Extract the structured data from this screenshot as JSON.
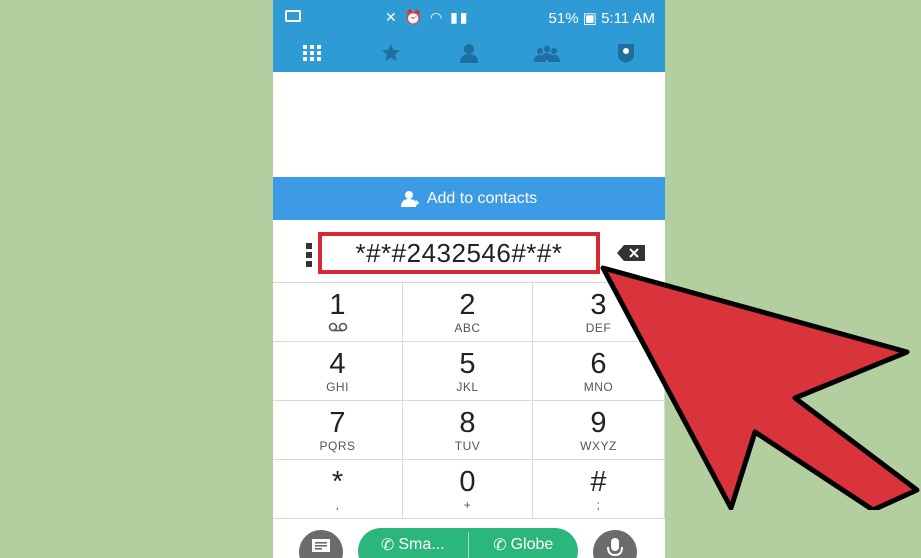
{
  "status_bar": {
    "battery": "51%",
    "time": "5:11 AM"
  },
  "tabs": [
    {
      "icon": "dialpad-icon"
    },
    {
      "icon": "star-icon"
    },
    {
      "icon": "person-icon"
    },
    {
      "icon": "group-icon"
    },
    {
      "icon": "shield-icon"
    }
  ],
  "add_contacts": {
    "label": "Add to contacts"
  },
  "dialed_number": "*#*#2432546#*#*",
  "keypad": [
    {
      "digit": "1",
      "letters": ""
    },
    {
      "digit": "2",
      "letters": "ABC"
    },
    {
      "digit": "3",
      "letters": "DEF"
    },
    {
      "digit": "4",
      "letters": "GHI"
    },
    {
      "digit": "5",
      "letters": "JKL"
    },
    {
      "digit": "6",
      "letters": "MNO"
    },
    {
      "digit": "7",
      "letters": "PQRS"
    },
    {
      "digit": "8",
      "letters": "TUV"
    },
    {
      "digit": "9",
      "letters": "WXYZ"
    },
    {
      "digit": "*",
      "letters": ","
    },
    {
      "digit": "0",
      "letters": "+"
    },
    {
      "digit": "#",
      "letters": ";"
    }
  ],
  "call_buttons": {
    "sim1": "Sma...",
    "sim2": "Globe"
  },
  "colors": {
    "background": "#b3cf9f",
    "header": "#2e9bd4",
    "add_bar": "#3d9be6",
    "highlight": "#d82832",
    "call_button": "#2bb67b"
  }
}
